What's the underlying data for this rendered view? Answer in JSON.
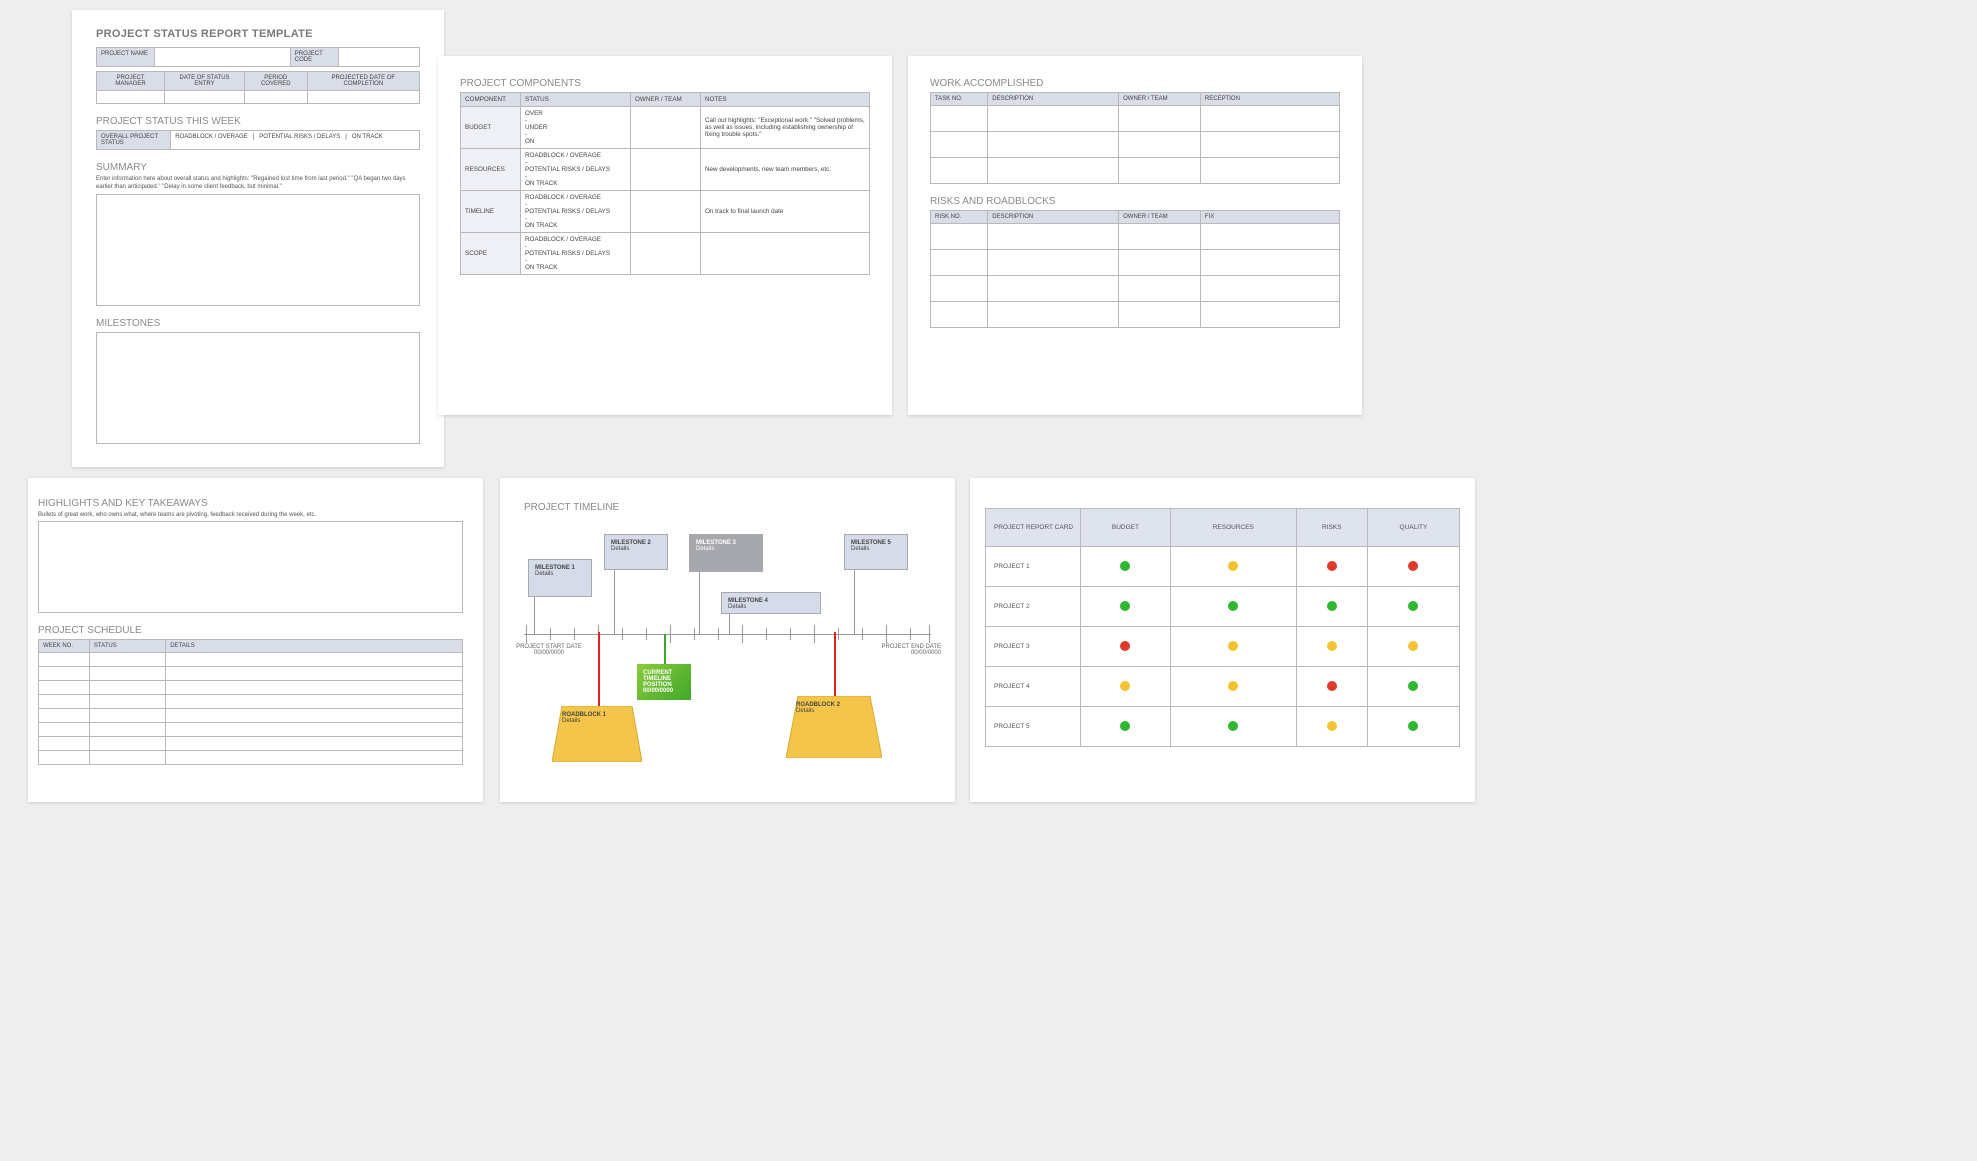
{
  "p1": {
    "title": "PROJECT STATUS REPORT TEMPLATE",
    "row1": {
      "name": "PROJECT NAME",
      "code": "PROJECT CODE"
    },
    "row2": {
      "pm": "PROJECT MANAGER",
      "dse": "DATE OF STATUS ENTRY",
      "pc": "PERIOD COVERED",
      "pd": "PROJECTED DATE OF COMPLETION"
    },
    "week_heading": "PROJECT STATUS THIS WEEK",
    "status_labels": {
      "overall": "OVERALL PROJECT STATUS",
      "ro": "ROADBLOCK / OVERAGE",
      "pr": "POTENTIAL RISKS / DELAYS",
      "ot": "ON TRACK",
      "sep": "|"
    },
    "summary_heading": "SUMMARY",
    "summary_text": "Enter information here about overall status and highlights: \"Regained lost time from last period.\" \"QA began two days earlier than anticipated.\" \"Delay in some client feedback, but minimal.\"",
    "milestones_heading": "MILESTONES"
  },
  "p2": {
    "title": "PROJECT COMPONENTS",
    "head": {
      "c": "COMPONENT",
      "s": "STATUS",
      "o": "OWNER / TEAM",
      "n": "NOTES"
    },
    "rows": [
      {
        "c": "BUDGET",
        "s": "OVER\n-\nUNDER\n-\nON",
        "n": "Call out highlights: \"Exceptional work.\" \"Solved problems, as well as issues, including establishing ownership of fixing trouble spots.\""
      },
      {
        "c": "RESOURCES",
        "s": "ROADBLOCK / OVERAGE\n-\nPOTENTIAL RISKS / DELAYS\n-\nON TRACK",
        "n": "New developments, new team members, etc."
      },
      {
        "c": "TIMELINE",
        "s": "ROADBLOCK / OVERAGE\n-\nPOTENTIAL RISKS / DELAYS\n-\nON TRACK",
        "n": "On track to final launch date"
      },
      {
        "c": "SCOPE",
        "s": "ROADBLOCK / OVERAGE\n-\nPOTENTIAL RISKS / DELAYS\n-\nON TRACK",
        "n": ""
      }
    ]
  },
  "p3": {
    "wa_title": "WORK ACCOMPLISHED",
    "wa_head": {
      "t": "TASK NO.",
      "d": "DESCRIPTION",
      "o": "OWNER / TEAM",
      "r": "RECEPTION"
    },
    "rr_title": "RISKS AND ROADBLOCKS",
    "rr_head": {
      "r": "RISK NO.",
      "d": "DESCRIPTION",
      "o": "OWNER / TEAM",
      "f": "FIX"
    }
  },
  "p4": {
    "hk_title": "HIGHLIGHTS AND KEY TAKEAWAYS",
    "hk_text": "Bullets of great work, who owns what, where teams are pivoting, feedback received during the week, etc.",
    "ps_title": "PROJECT SCHEDULE",
    "head": {
      "w": "WEEK NO.",
      "s": "STATUS",
      "d": "DETAILS"
    }
  },
  "p5": {
    "title": "PROJECT TIMELINE",
    "start_label": "PROJECT START DATE",
    "end_label": "PROJECT END DATE",
    "date_placeholder": "00/00/0000",
    "milestones": [
      {
        "name": "MILESTONE 1",
        "d": "Details"
      },
      {
        "name": "MILESTONE 2",
        "d": "Details"
      },
      {
        "name": "MILESTONE 3",
        "d": "Details"
      },
      {
        "name": "MILESTONE 4",
        "d": "Details"
      },
      {
        "name": "MILESTONE 5",
        "d": "Details"
      }
    ],
    "current": "CURRENT TIMELINE POSITION",
    "roadblocks": [
      {
        "name": "ROADBLOCK 1",
        "d": "Details"
      },
      {
        "name": "ROADBLOCK 2",
        "d": "Details"
      }
    ]
  },
  "p6": {
    "head": {
      "p": "PROJECT REPORT CARD",
      "b": "BUDGET",
      "r": "RESOURCES",
      "k": "RISKS",
      "q": "QUALITY"
    },
    "rows": [
      {
        "p": "PROJECT 1",
        "b": "g",
        "r": "y",
        "k": "r",
        "q": "r"
      },
      {
        "p": "PROJECT 2",
        "b": "g",
        "r": "g",
        "k": "g",
        "q": "g"
      },
      {
        "p": "PROJECT 3",
        "b": "r",
        "r": "y",
        "k": "y",
        "q": "y"
      },
      {
        "p": "PROJECT 4",
        "b": "y",
        "r": "y",
        "k": "r",
        "q": "g"
      },
      {
        "p": "PROJECT 5",
        "b": "g",
        "r": "g",
        "k": "y",
        "q": "g"
      }
    ]
  }
}
